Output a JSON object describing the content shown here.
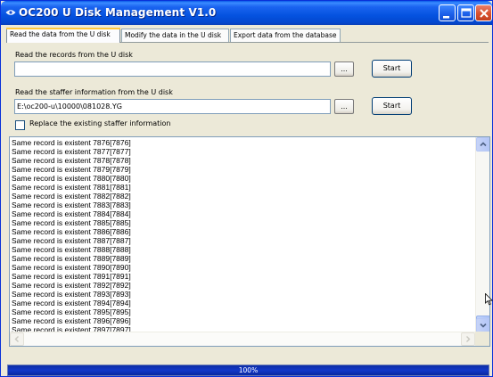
{
  "window": {
    "title": "OC200 U Disk Management V1.0",
    "accent_color": "#0553e0",
    "controls": [
      "minimize-icon",
      "maximize-icon",
      "close-icon"
    ]
  },
  "tabs": [
    {
      "label": "Read the data from the U disk",
      "active": true
    },
    {
      "label": "Modify the data in the U disk",
      "active": false
    },
    {
      "label": "Export data from the database",
      "active": false
    }
  ],
  "read_records": {
    "label": "Read the records from the U disk",
    "path_value": "",
    "browse_label": "...",
    "start_label": "Start"
  },
  "read_staffer": {
    "label": "Read the staffer information from the U disk",
    "path_value": "E:\\oc200-u\\10000\\081028.YG",
    "browse_label": "...",
    "start_label": "Start"
  },
  "replace_option": {
    "label": "Replace the existing staffer information",
    "checked": false
  },
  "log": {
    "lines": [
      "Same record is existent 7876[7876]",
      "Same record is existent 7877[7877]",
      "Same record is existent 7878[7878]",
      "Same record is existent 7879[7879]",
      "Same record is existent 7880[7880]",
      "Same record is existent 7881[7881]",
      "Same record is existent 7882[7882]",
      "Same record is existent 7883[7883]",
      "Same record is existent 7884[7884]",
      "Same record is existent 7885[7885]",
      "Same record is existent 7886[7886]",
      "Same record is existent 7887[7887]",
      "Same record is existent 7888[7888]",
      "Same record is existent 7889[7889]",
      "Same record is existent 7890[7890]",
      "Same record is existent 7891[7891]",
      "Same record is existent 7892[7892]",
      "Same record is existent 7893[7893]",
      "Same record is existent 7894[7894]",
      "Same record is existent 7895[7895]",
      "Same record is existent 7896[7896]",
      "Same record is existent 7897[7897]"
    ]
  },
  "progress": {
    "text": "100%",
    "fraction": 1.0
  }
}
